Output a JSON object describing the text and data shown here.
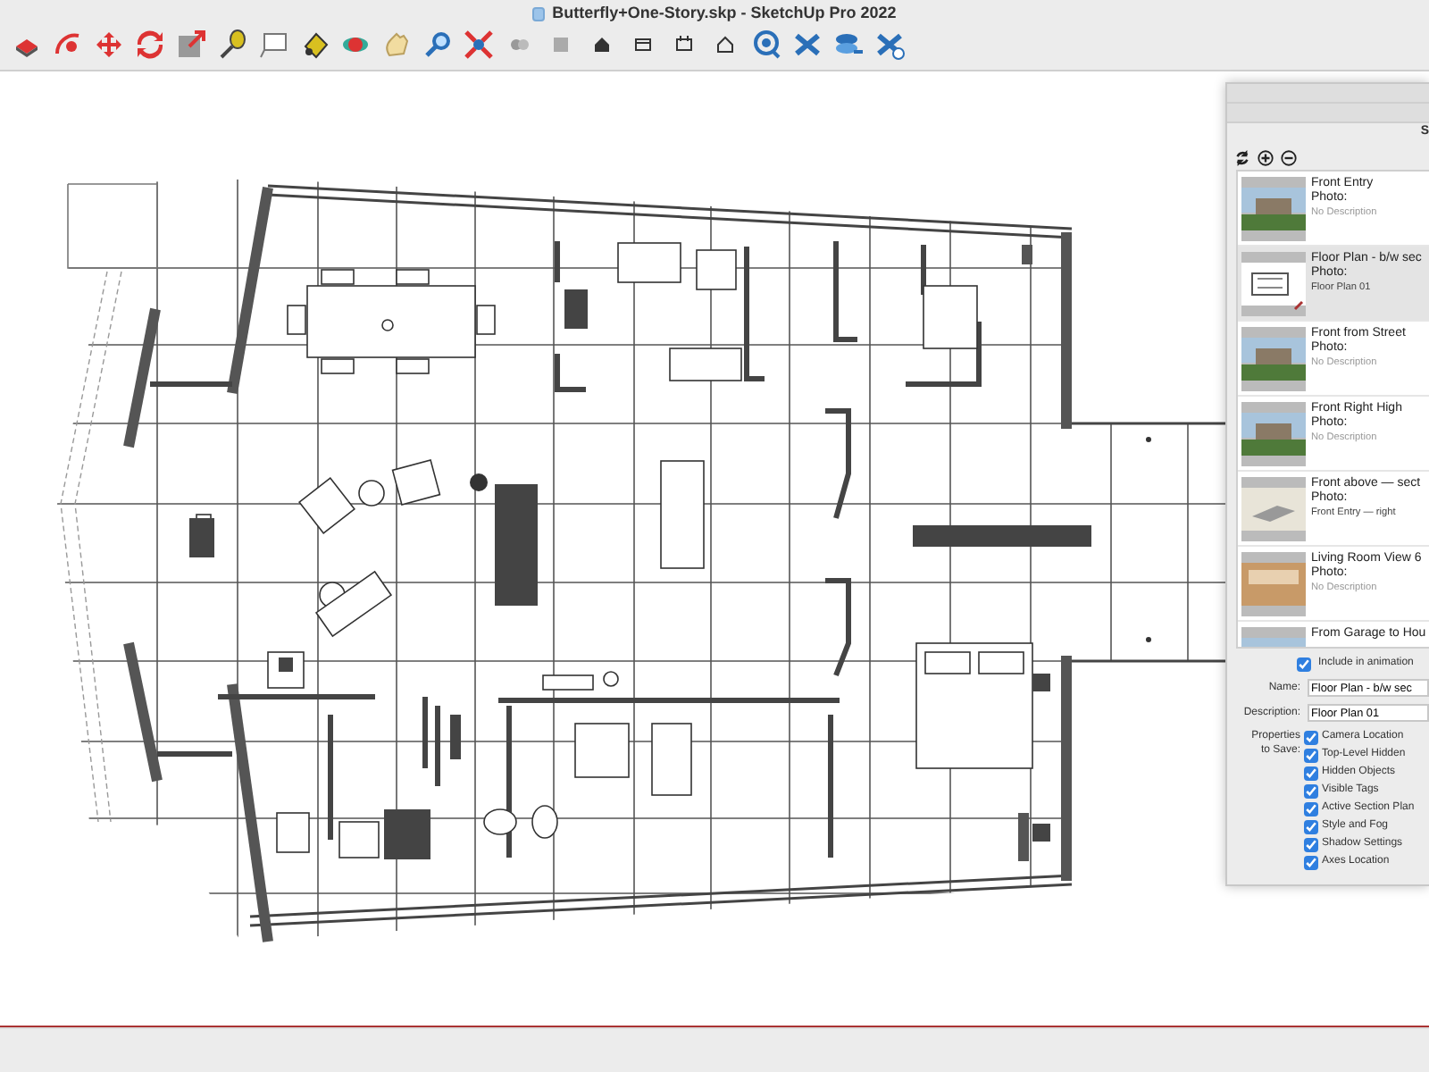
{
  "window": {
    "title": "Butterfly+One-Story.skp - SketchUp Pro 2022"
  },
  "scenes_panel": {
    "title": "S",
    "scenes": [
      {
        "title": "Front Entry",
        "photo_label": "Photo:",
        "placeholder": "No Description",
        "kind": "render",
        "selected": false
      },
      {
        "title": "Floor Plan - b/w sec",
        "photo_label": "Photo:",
        "description": "Floor Plan 01",
        "kind": "plan",
        "selected": true
      },
      {
        "title": "Front from Street",
        "photo_label": "Photo:",
        "placeholder": "No Description",
        "kind": "render",
        "selected": false
      },
      {
        "title": "Front Right High",
        "photo_label": "Photo:",
        "placeholder": "No Description",
        "kind": "render",
        "selected": false
      },
      {
        "title": "Front above — sect",
        "photo_label": "Photo:",
        "description": "Front Entry — right",
        "kind": "section",
        "selected": false
      },
      {
        "title": "Living Room View 6",
        "photo_label": "Photo:",
        "placeholder": "No Description",
        "kind": "interior",
        "selected": false
      },
      {
        "title": "From Garage to Hou",
        "kind": "render",
        "selected": false
      }
    ],
    "include_in_animation": {
      "label": "Include in animation",
      "checked": true
    },
    "name": {
      "label": "Name:",
      "value": "Floor Plan - b/w sec"
    },
    "description": {
      "label": "Description:",
      "value": "Floor Plan 01"
    },
    "properties": {
      "label": "Properties to Save:",
      "items": [
        {
          "label": "Camera Location",
          "checked": true
        },
        {
          "label": "Top-Level Hidden",
          "checked": true
        },
        {
          "label": "Hidden Objects",
          "checked": true
        },
        {
          "label": "Visible Tags",
          "checked": true
        },
        {
          "label": "Active Section Plan",
          "checked": true
        },
        {
          "label": "Style and Fog",
          "checked": true
        },
        {
          "label": "Shadow Settings",
          "checked": true
        },
        {
          "label": "Axes Location",
          "checked": true
        }
      ]
    }
  }
}
